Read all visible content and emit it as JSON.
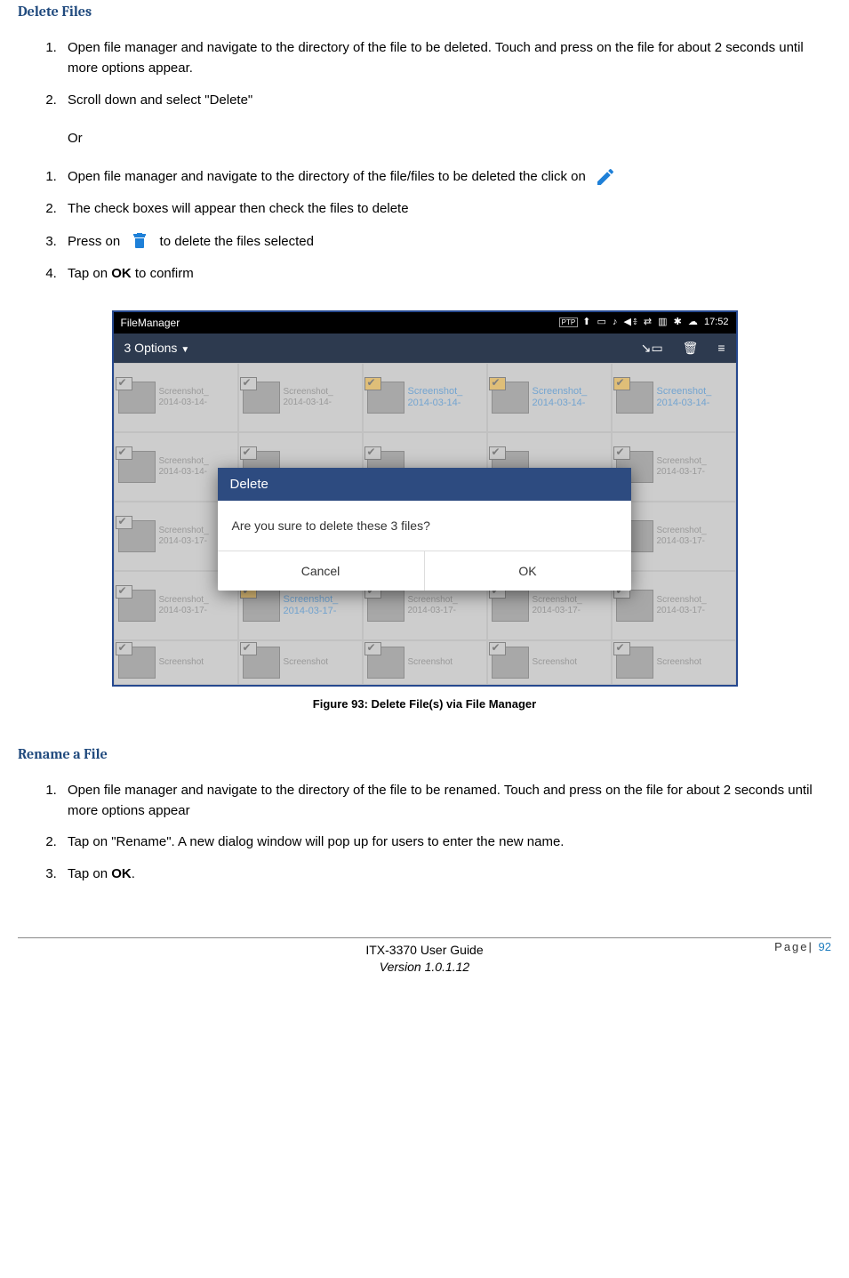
{
  "section1": {
    "title": "Delete Files",
    "steps_a": [
      "Open file manager and navigate to the directory of the file to be deleted. Touch and press on the file for about 2 seconds until more options appear.",
      "Scroll down and select \"Delete\""
    ],
    "or": "Or",
    "steps_b": {
      "s1": "Open file manager and navigate to the directory of the file/files to be deleted the click on",
      "s2": "The check boxes will appear then check the files to delete",
      "s3a": "Press on",
      "s3b": "to delete the files selected",
      "s4a": "Tap on ",
      "s4b": "OK",
      "s4c": " to confirm"
    }
  },
  "screenshot": {
    "app_title": "FileManager",
    "time": "17:52",
    "toolbar_title": "3 Options",
    "files": {
      "name1a": "Screenshot_",
      "name1b": "2014-03-14-",
      "name2b": "2014-03-17-",
      "last": "Screenshot"
    },
    "dialog": {
      "title": "Delete",
      "body": "Are you sure to delete these  3 files?",
      "cancel": "Cancel",
      "ok": "OK"
    }
  },
  "figure_caption": "Figure 93: Delete File(s) via File Manager",
  "section2": {
    "title": "Rename a File",
    "steps": [
      "Open file manager and navigate to the directory of the file to be renamed. Touch and press on the file for about 2 seconds until more options appear",
      "Tap on \"Rename\". A new dialog window will pop up for users to enter the new name."
    ],
    "s3a": "Tap on ",
    "s3b": "OK",
    "s3c": "."
  },
  "footer": {
    "page_label": "Page|",
    "page_no": "92",
    "line1": "ITX-3370 User Guide",
    "line2": "Version 1.0.1.12"
  }
}
